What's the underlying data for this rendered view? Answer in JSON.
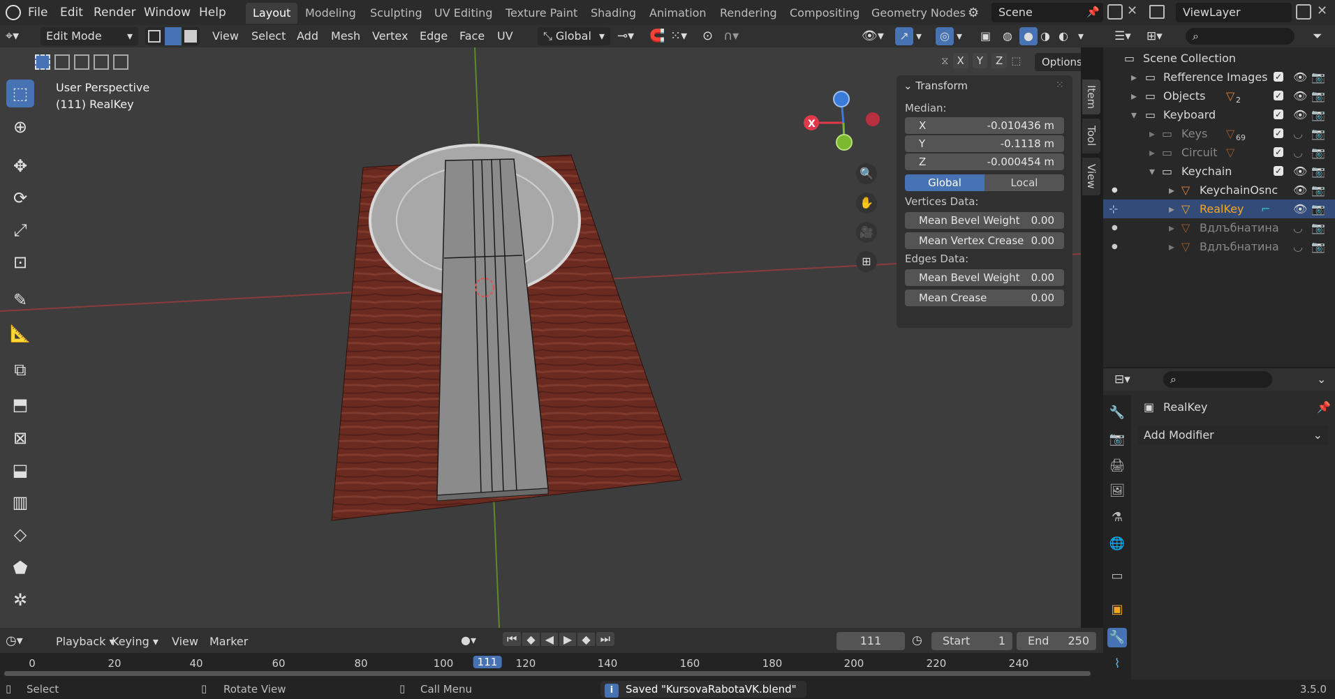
{
  "topbar": {
    "menus": [
      "File",
      "Edit",
      "Render",
      "Window",
      "Help"
    ],
    "workspaces": [
      "Layout",
      "Modeling",
      "Sculpting",
      "UV Editing",
      "Texture Paint",
      "Shading",
      "Animation",
      "Rendering",
      "Compositing",
      "Geometry Nodes"
    ],
    "active_workspace": "Layout",
    "scene": "Scene",
    "view_layer": "ViewLayer"
  },
  "header": {
    "mode": "Edit Mode",
    "menus": [
      "View",
      "Select",
      "Add",
      "Mesh",
      "Vertex",
      "Edge",
      "Face",
      "UV"
    ],
    "orientation": "Global",
    "options_label": "Options",
    "axes": [
      "X",
      "Y",
      "Z"
    ]
  },
  "viewport": {
    "view_name": "User Perspective",
    "object_info": "(111) RealKey",
    "gizmo_labels": {
      "x": "X"
    }
  },
  "npanel": {
    "title": "Transform",
    "median_label": "Median:",
    "x_label": "X",
    "x_value": "-0.010436 m",
    "y_label": "Y",
    "y_value": "-0.1118 m",
    "z_label": "Z",
    "z_value": "-0.000454 m",
    "global_label": "Global",
    "local_label": "Local",
    "vertices_label": "Vertices Data:",
    "v_bevel_label": "Mean Bevel Weight",
    "v_bevel_value": "0.00",
    "v_crease_label": "Mean Vertex Crease",
    "v_crease_value": "0.00",
    "edges_label": "Edges Data:",
    "e_bevel_label": "Mean Bevel Weight",
    "e_bevel_value": "0.00",
    "e_crease_label": "Mean Crease",
    "e_crease_value": "0.00",
    "tabs": [
      "Item",
      "Tool",
      "View"
    ]
  },
  "outliner": {
    "root": "Scene Collection",
    "items": [
      {
        "label": "Refference Images",
        "badge": ""
      },
      {
        "label": "Objects",
        "badge": "2"
      },
      {
        "label": "Keyboard",
        "badge": ""
      },
      {
        "label": "Keys",
        "badge": "69"
      },
      {
        "label": "Circuit",
        "badge": ""
      },
      {
        "label": "Keychain",
        "badge": ""
      },
      {
        "label": "KeychainOsnc",
        "badge": ""
      },
      {
        "label": "RealKey",
        "badge": ""
      },
      {
        "label": "Вдлъбнатина",
        "badge": ""
      },
      {
        "label": "Вдлъбнатина",
        "badge": ""
      }
    ]
  },
  "properties": {
    "object_name": "RealKey",
    "add_modifier": "Add Modifier"
  },
  "timeline": {
    "menus": [
      "Playback",
      "Keying",
      "View",
      "Marker"
    ],
    "current_frame": "111",
    "start_label": "Start",
    "start_value": "1",
    "end_label": "End",
    "end_value": "250",
    "ticks": [
      "0",
      "20",
      "40",
      "60",
      "80",
      "100",
      "111",
      "120",
      "140",
      "160",
      "180",
      "200",
      "220",
      "240"
    ]
  },
  "status": {
    "select": "Select",
    "rotate": "Rotate View",
    "call_menu": "Call Menu",
    "message": "Saved \"KursovaRabotaVK.blend\"",
    "version": "3.5.0"
  },
  "colors": {
    "accent": "#4772b3",
    "selected_object": "#f5a623",
    "x_axis": "#e03a4a",
    "y_axis": "#7bb82e",
    "z_axis": "#3a7ad8"
  }
}
